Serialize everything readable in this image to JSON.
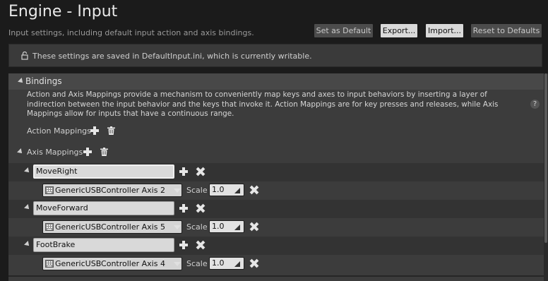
{
  "header": {
    "title": "Engine - Input",
    "subtitle": "Input settings, including default input action and axis bindings.",
    "buttons": {
      "set_default": "Set as Default",
      "export": "Export...",
      "import": "Import...",
      "reset": "Reset to Defaults"
    }
  },
  "notice": {
    "text": "These settings are saved in DefaultInput.ini, which is currently writable.",
    "icon": "lock-icon"
  },
  "bindings": {
    "category_label": "Bindings",
    "description": "Action and Axis Mappings provide a mechanism to conveniently map keys and axes to input behaviors by inserting a layer of indirection between the input behavior and the keys that invoke it. Action Mappings are for key presses and releases, while Axis Mappings allow for inputs that have a continuous range.",
    "help_icon": "?",
    "action_mappings_label": "Action Mappings",
    "axis_mappings_label": "Axis Mappings",
    "scale_label": "Scale",
    "axis_mappings": [
      {
        "name": "MoveRight",
        "key": "GenericUSBController Axis 2",
        "scale": "1.0"
      },
      {
        "name": "MoveForward",
        "key": "GenericUSBController Axis 5",
        "scale": "1.0"
      },
      {
        "name": "FootBrake",
        "key": "GenericUSBController Axis 4",
        "scale": "1.0"
      }
    ]
  },
  "colors": {
    "background": "#1b1b1b",
    "panel": "#3c3c3c",
    "button_disabled": "#4c4c4c",
    "button_enabled": "#d9d9d9"
  }
}
